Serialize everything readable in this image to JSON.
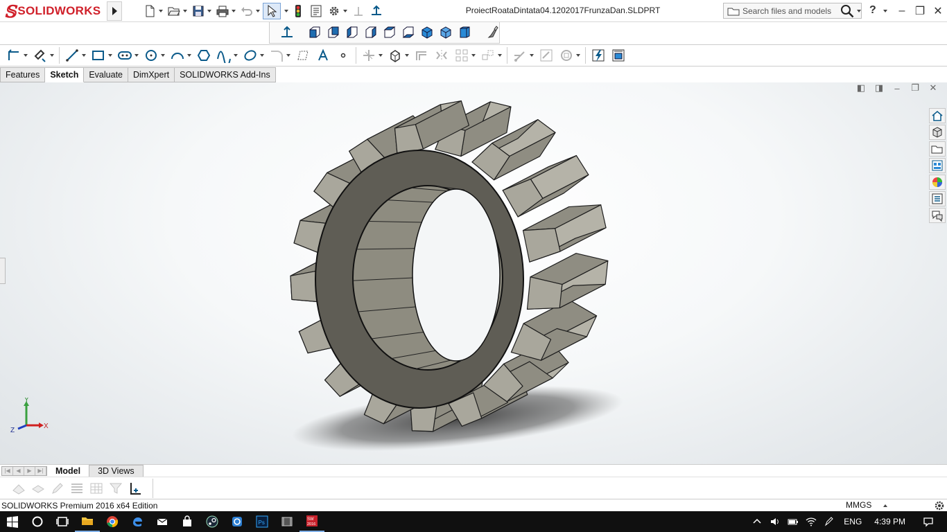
{
  "app": {
    "brand": "SOLIDWORKS",
    "document_title": "ProiectRoataDintata04.1202017FrunzaDan.SLDPRT"
  },
  "search": {
    "placeholder": "Search files and models"
  },
  "help_label": "?",
  "cmd_tabs": [
    {
      "label": "Features",
      "active": false
    },
    {
      "label": "Sketch",
      "active": true
    },
    {
      "label": "Evaluate",
      "active": false
    },
    {
      "label": "DimXpert",
      "active": false
    },
    {
      "label": "SOLIDWORKS Add-Ins",
      "active": false
    }
  ],
  "triad": {
    "y": "Y",
    "x": "X",
    "z": "Z"
  },
  "bottom_tabs": [
    {
      "label": "Model",
      "active": true
    },
    {
      "label": "3D Views",
      "active": false
    }
  ],
  "status": {
    "edition": "SOLIDWORKS Premium 2016 x64 Edition",
    "units": "MMGS"
  },
  "tray": {
    "language": "ENG",
    "time": "4:39 PM"
  },
  "colors": {
    "brand_red": "#d0202a",
    "gear_face": "#5f5d55",
    "gear_teeth": "#a9a79c",
    "taskbar": "#101010"
  }
}
